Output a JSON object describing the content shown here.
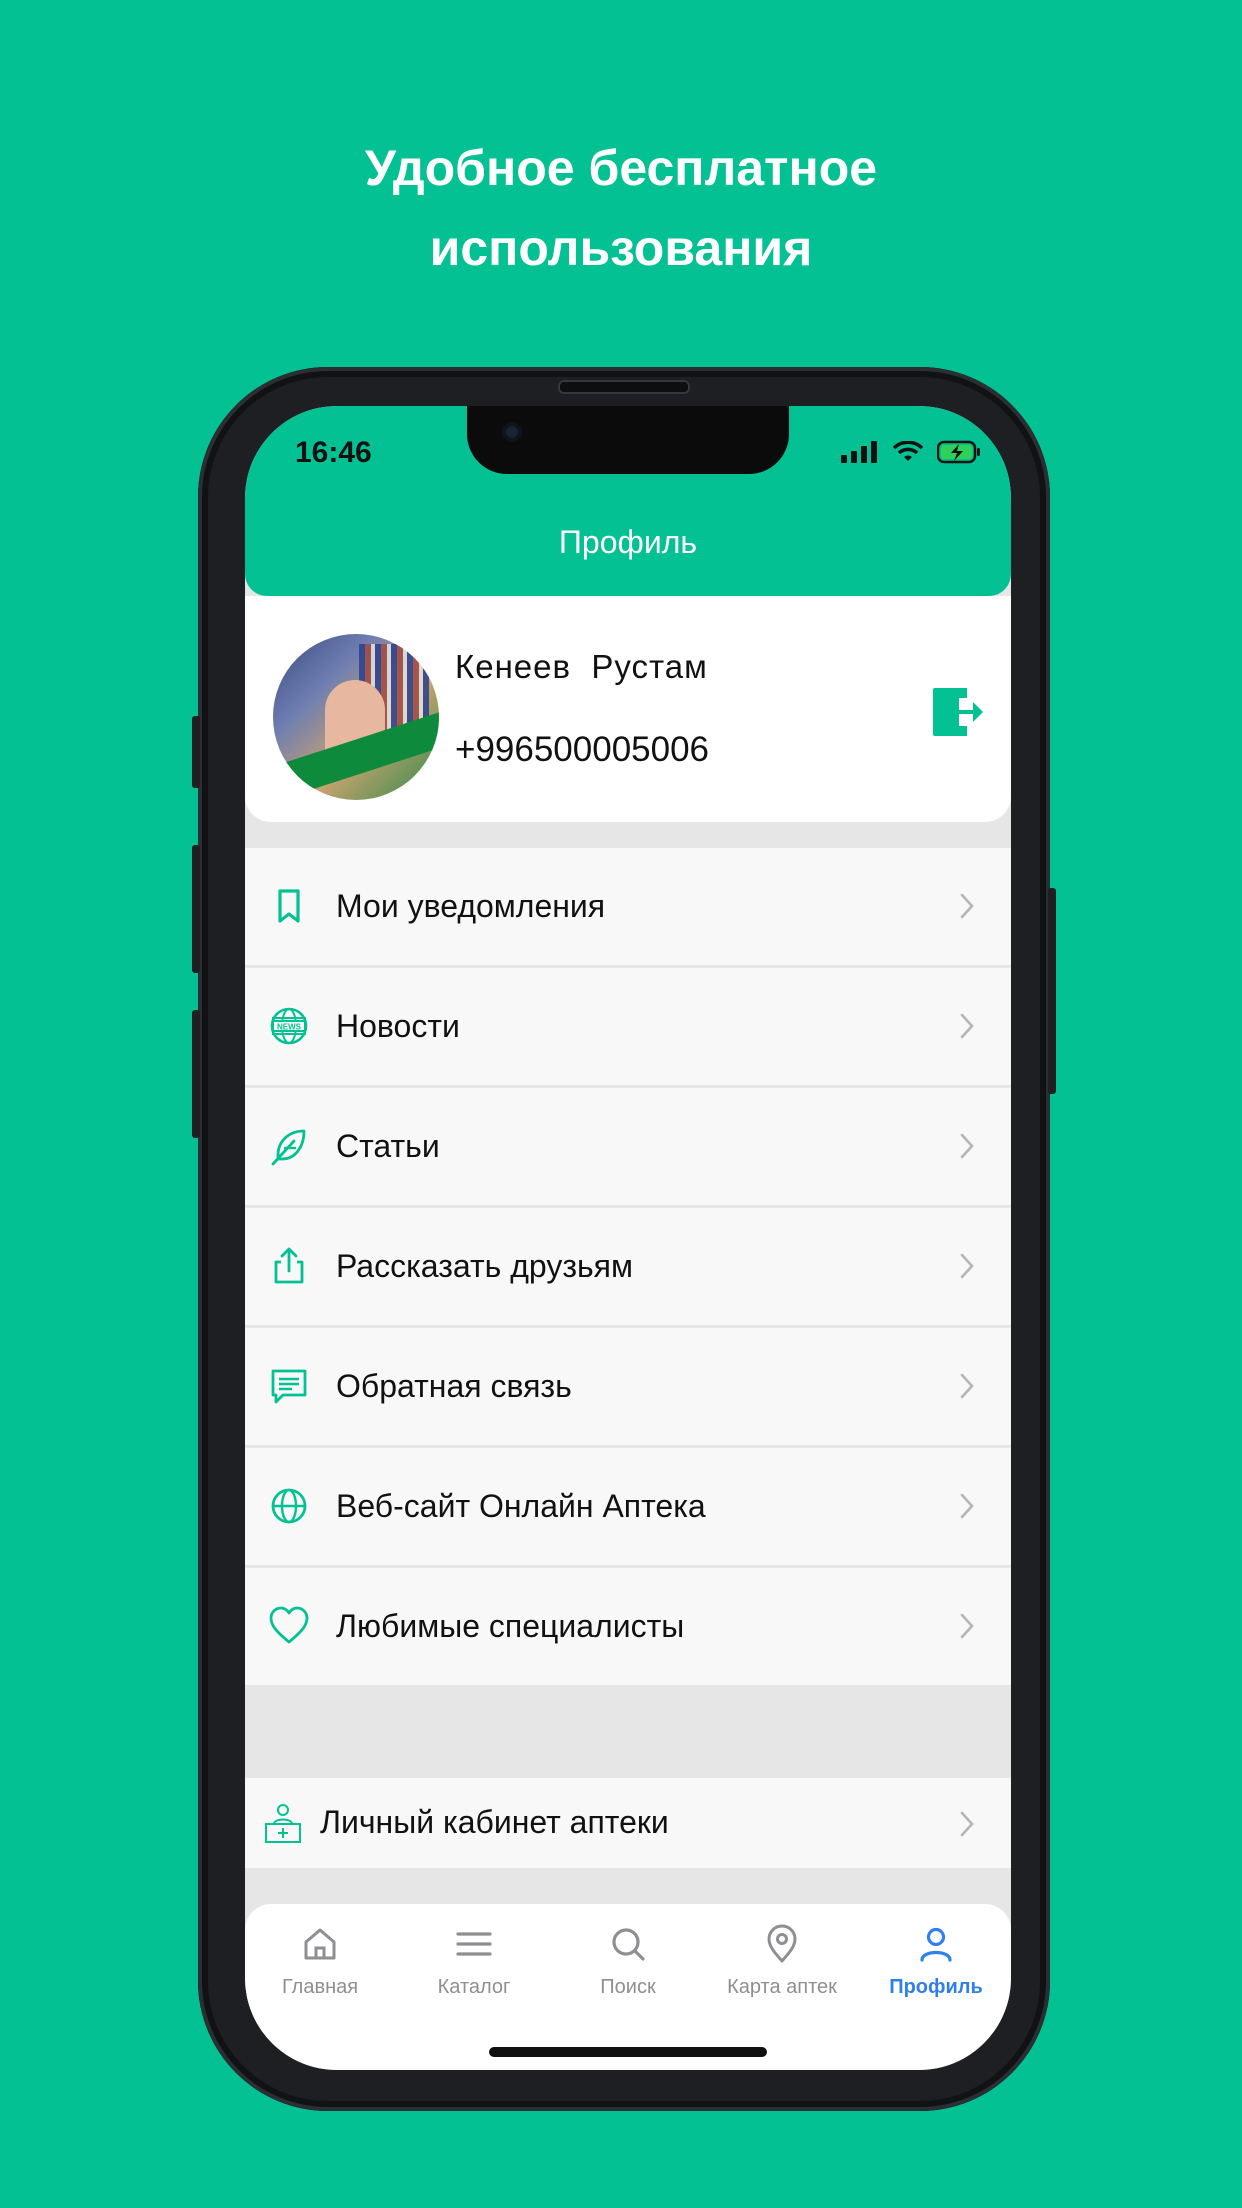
{
  "promo": {
    "line1": "Удобное бесплатное",
    "line2": "использования"
  },
  "status_bar": {
    "time": "16:46"
  },
  "header": {
    "title": "Профиль"
  },
  "profile": {
    "name": "Кенеев  Рустам",
    "phone": "+996500005006"
  },
  "menu": [
    {
      "label": "Мои уведомления",
      "icon": "bookmark-icon"
    },
    {
      "label": "Новости",
      "icon": "news-globe-icon"
    },
    {
      "label": "Статьи",
      "icon": "feather-icon"
    },
    {
      "label": "Рассказать друзьям",
      "icon": "share-icon"
    },
    {
      "label": "Обратная связь",
      "icon": "message-icon"
    },
    {
      "label": "Веб-сайт Онлайн Аптека",
      "icon": "globe-icon"
    },
    {
      "label": "Любимые специалисты",
      "icon": "heart-icon"
    }
  ],
  "cabinet": {
    "label": "Личный кабинет аптеки",
    "icon": "pharmacist-icon"
  },
  "tabbar": [
    {
      "label": "Главная",
      "icon": "home-icon"
    },
    {
      "label": "Каталог",
      "icon": "menu-icon"
    },
    {
      "label": "Поиск",
      "icon": "search-icon"
    },
    {
      "label": "Карта аптек",
      "icon": "map-pin-icon"
    },
    {
      "label": "Профиль",
      "icon": "user-icon",
      "active": true
    }
  ],
  "colors": {
    "brand": "#03C193",
    "active_tab": "#2F80ED",
    "row_bg": "#F8F8F8"
  }
}
